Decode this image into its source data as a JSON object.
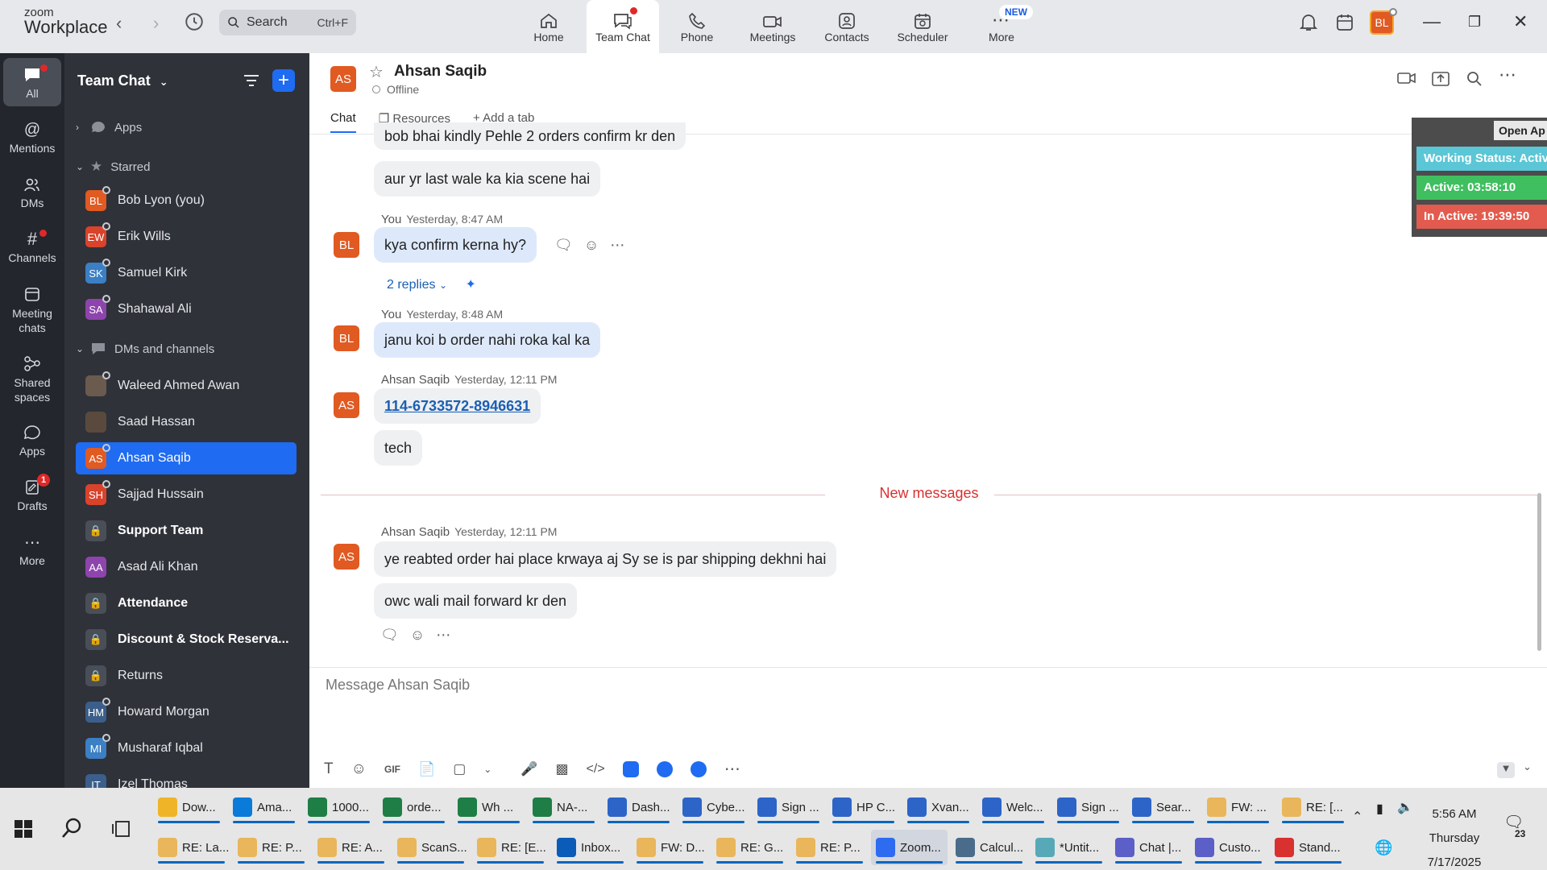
{
  "app": {
    "logo_small": "zoom",
    "logo_big": "Workplace"
  },
  "search": {
    "placeholder": "Search",
    "shortcut": "Ctrl+F"
  },
  "topnav": [
    {
      "label": "Home"
    },
    {
      "label": "Team Chat"
    },
    {
      "label": "Phone"
    },
    {
      "label": "Meetings"
    },
    {
      "label": "Contacts"
    },
    {
      "label": "Scheduler"
    },
    {
      "label": "More"
    }
  ],
  "topnav_badge": "NEW",
  "user_avatar": "BL",
  "rail": [
    {
      "label": "All"
    },
    {
      "label": "Mentions"
    },
    {
      "label": "DMs"
    },
    {
      "label": "Channels"
    },
    {
      "label": "Meeting chats"
    },
    {
      "label": "Shared spaces"
    },
    {
      "label": "Apps"
    },
    {
      "label": "Drafts"
    },
    {
      "label": "More"
    }
  ],
  "rail_drafts_badge": "1",
  "sidebar": {
    "title": "Team Chat",
    "sections": {
      "apps": "Apps",
      "starred": "Starred",
      "dms": "DMs and channels"
    },
    "starred": [
      {
        "initials": "BL",
        "name": "Bob Lyon (you)",
        "color": "#e05a22"
      },
      {
        "initials": "EW",
        "name": "Erik Wills",
        "color": "#d9432b"
      },
      {
        "initials": "SK",
        "name": "Samuel Kirk",
        "color": "#3b7fc4"
      },
      {
        "initials": "SA",
        "name": "Shahawal Ali",
        "color": "#8e44ad"
      }
    ],
    "dms": [
      {
        "initials": "",
        "name": "Waleed Ahmed Awan",
        "color": "#6b5a4e"
      },
      {
        "initials": "",
        "name": "Saad Hassan",
        "color": "#5a4a3e"
      },
      {
        "initials": "AS",
        "name": "Ahsan Saqib",
        "color": "#e05a22"
      },
      {
        "initials": "SH",
        "name": "Sajjad Hussain",
        "color": "#d9432b"
      },
      {
        "initials": "",
        "name": "Support Team",
        "color": "#4a4e57"
      },
      {
        "initials": "AA",
        "name": "Asad Ali Khan",
        "color": "#8e44ad"
      },
      {
        "initials": "",
        "name": "Attendance",
        "color": "#4a4e57"
      },
      {
        "initials": "",
        "name": "Discount & Stock Reserva...",
        "color": "#4a4e57"
      },
      {
        "initials": "",
        "name": "Returns",
        "color": "#4a4e57"
      },
      {
        "initials": "HM",
        "name": "Howard Morgan",
        "color": "#3b5f8a"
      },
      {
        "initials": "MI",
        "name": "Musharaf Iqbal",
        "color": "#3b7fc4"
      },
      {
        "initials": "IT",
        "name": "Izel Thomas",
        "color": "#3b5f8a"
      }
    ]
  },
  "chat": {
    "contact_initials": "AS",
    "contact_name": "Ahsan Saqib",
    "status": "Offline",
    "tabs": {
      "chat": "Chat",
      "resources": "Resources",
      "add": "Add a tab"
    },
    "messages": {
      "m1": "bob bhai kindly Pehle 2 orders confirm kr den",
      "m2": "aur yr last wale ka kia scene hai",
      "meta3_who": "You",
      "meta3_time": "Yesterday, 8:47 AM",
      "m3": "kya confirm kerna hy?",
      "replies": "2 replies",
      "meta4_who": "You",
      "meta4_time": "Yesterday, 8:48 AM",
      "m4": "janu koi b order nahi roka kal ka",
      "meta5_who": "Ahsan Saqib",
      "meta5_time": "Yesterday, 12:11 PM",
      "m5": "114-6733572-8946631",
      "m6": "tech",
      "new_messages": "New messages",
      "meta7_who": "Ahsan Saqib",
      "meta7_time": "Yesterday, 12:11 PM",
      "m7": "ye reabted order hai place krwaya aj Sy se is par shipping dekhni hai",
      "m8": "owc wali mail forward kr den"
    },
    "avatar_bl": "BL",
    "avatar_as": "AS",
    "composer_placeholder": "Message Ahsan Saqib",
    "toolbar_gif": "GIF"
  },
  "widget": {
    "open": "Open Ap",
    "working": "Working Status: Activ",
    "active": "Active: 03:58:10",
    "inactive": "In Active: 19:39:50"
  },
  "taskbar": {
    "row1": [
      "Dow...",
      "Ama...",
      "1000...",
      "orde...",
      "Wh ...",
      "NA-...",
      "Dash...",
      "Cybe...",
      "Sign ...",
      "HP C...",
      "Xvan...",
      "Welc...",
      "Sign ...",
      "Sear...",
      "FW: ...",
      "RE: [..."
    ],
    "row2": [
      "RE: La...",
      "RE: P...",
      "RE: A...",
      "ScanS...",
      "RE: [E...",
      "Inbox...",
      "FW: D...",
      "RE: G...",
      "RE: P...",
      "Zoom...",
      "Calcul...",
      "*Untit...",
      "Chat |...",
      "Custo...",
      "Stand..."
    ],
    "time": "5:56 AM",
    "day": "Thursday",
    "date": "7/17/2025",
    "notif": "23"
  },
  "colors": {
    "accent": "#1f6bf1",
    "avatar_orange": "#e05a22",
    "new_messages": "#d93030",
    "link": "#1a5fb4"
  }
}
